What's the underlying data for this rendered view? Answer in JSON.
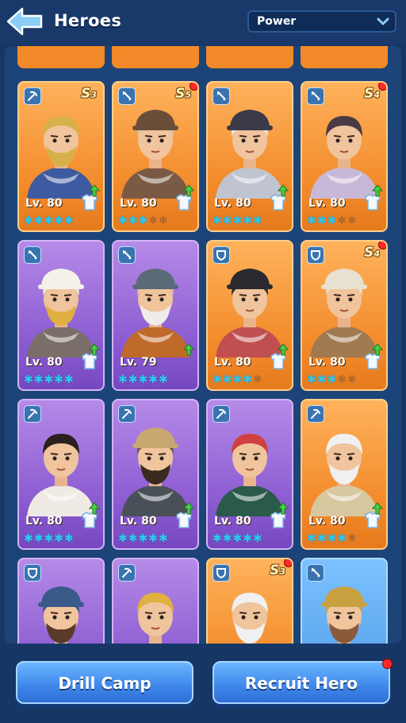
{
  "header": {
    "title": "Heroes",
    "sort_label": "Power"
  },
  "buttons": {
    "drill_camp": "Drill Camp",
    "recruit_hero": "Recruit Hero"
  },
  "colors": {
    "orange": "#f28a2a",
    "purple": "#8a5ad0",
    "blue": "#4c98e6",
    "star": "#30c8f0",
    "background": "#163766"
  },
  "heroes": [
    {
      "rarity": "orange",
      "class_icon": "pickaxe-icon",
      "tier": "S",
      "tier_num": "3",
      "red_dot": false,
      "level": "Lv. 80",
      "stars": 5,
      "upgrade": true,
      "gear": true
    },
    {
      "rarity": "orange",
      "class_icon": "bow-icon",
      "tier": "S",
      "tier_num": "5",
      "red_dot": true,
      "level": "Lv. 80",
      "stars": 3,
      "upgrade": true,
      "gear": true
    },
    {
      "rarity": "orange",
      "class_icon": "bow-icon",
      "tier": "",
      "tier_num": "",
      "red_dot": false,
      "level": "Lv. 80",
      "stars": 5,
      "upgrade": true,
      "gear": true
    },
    {
      "rarity": "orange",
      "class_icon": "bow-icon",
      "tier": "S",
      "tier_num": "4",
      "red_dot": true,
      "level": "Lv. 80",
      "stars": 3,
      "upgrade": true,
      "gear": true
    },
    {
      "rarity": "purple",
      "class_icon": "bow-icon",
      "tier": "",
      "tier_num": "",
      "red_dot": false,
      "level": "Lv. 80",
      "stars": 5,
      "upgrade": true,
      "gear": true
    },
    {
      "rarity": "purple",
      "class_icon": "bow-icon",
      "tier": "",
      "tier_num": "",
      "red_dot": false,
      "level": "Lv. 79",
      "stars": 5,
      "upgrade": true,
      "gear": false
    },
    {
      "rarity": "orange",
      "class_icon": "shield-icon",
      "tier": "",
      "tier_num": "",
      "red_dot": false,
      "level": "Lv. 80",
      "stars": 4,
      "upgrade": true,
      "gear": true
    },
    {
      "rarity": "orange",
      "class_icon": "shield-icon",
      "tier": "S",
      "tier_num": "4",
      "red_dot": true,
      "level": "Lv. 80",
      "stars": 3,
      "upgrade": true,
      "gear": true
    },
    {
      "rarity": "purple",
      "class_icon": "pickaxe-icon",
      "tier": "",
      "tier_num": "",
      "red_dot": false,
      "level": "Lv. 80",
      "stars": 5,
      "upgrade": true,
      "gear": true
    },
    {
      "rarity": "purple",
      "class_icon": "pickaxe-icon",
      "tier": "",
      "tier_num": "",
      "red_dot": false,
      "level": "Lv. 80",
      "stars": 5,
      "upgrade": true,
      "gear": true
    },
    {
      "rarity": "purple",
      "class_icon": "pickaxe-icon",
      "tier": "",
      "tier_num": "",
      "red_dot": false,
      "level": "Lv. 80",
      "stars": 5,
      "upgrade": true,
      "gear": true
    },
    {
      "rarity": "orange",
      "class_icon": "pickaxe-icon",
      "tier": "",
      "tier_num": "",
      "red_dot": false,
      "level": "Lv. 80",
      "stars": 4,
      "upgrade": true,
      "gear": true
    },
    {
      "rarity": "purple",
      "class_icon": "shield-icon",
      "tier": "",
      "tier_num": "",
      "red_dot": false,
      "level": "",
      "stars": 0,
      "upgrade": false,
      "gear": false
    },
    {
      "rarity": "purple",
      "class_icon": "pickaxe-icon",
      "tier": "",
      "tier_num": "",
      "red_dot": false,
      "level": "",
      "stars": 0,
      "upgrade": false,
      "gear": false
    },
    {
      "rarity": "orange",
      "class_icon": "shield-icon",
      "tier": "S",
      "tier_num": "3",
      "red_dot": true,
      "level": "",
      "stars": 0,
      "upgrade": false,
      "gear": false
    },
    {
      "rarity": "blue",
      "class_icon": "bow-icon",
      "tier": "",
      "tier_num": "",
      "red_dot": false,
      "level": "",
      "stars": 0,
      "upgrade": false,
      "gear": false
    }
  ]
}
